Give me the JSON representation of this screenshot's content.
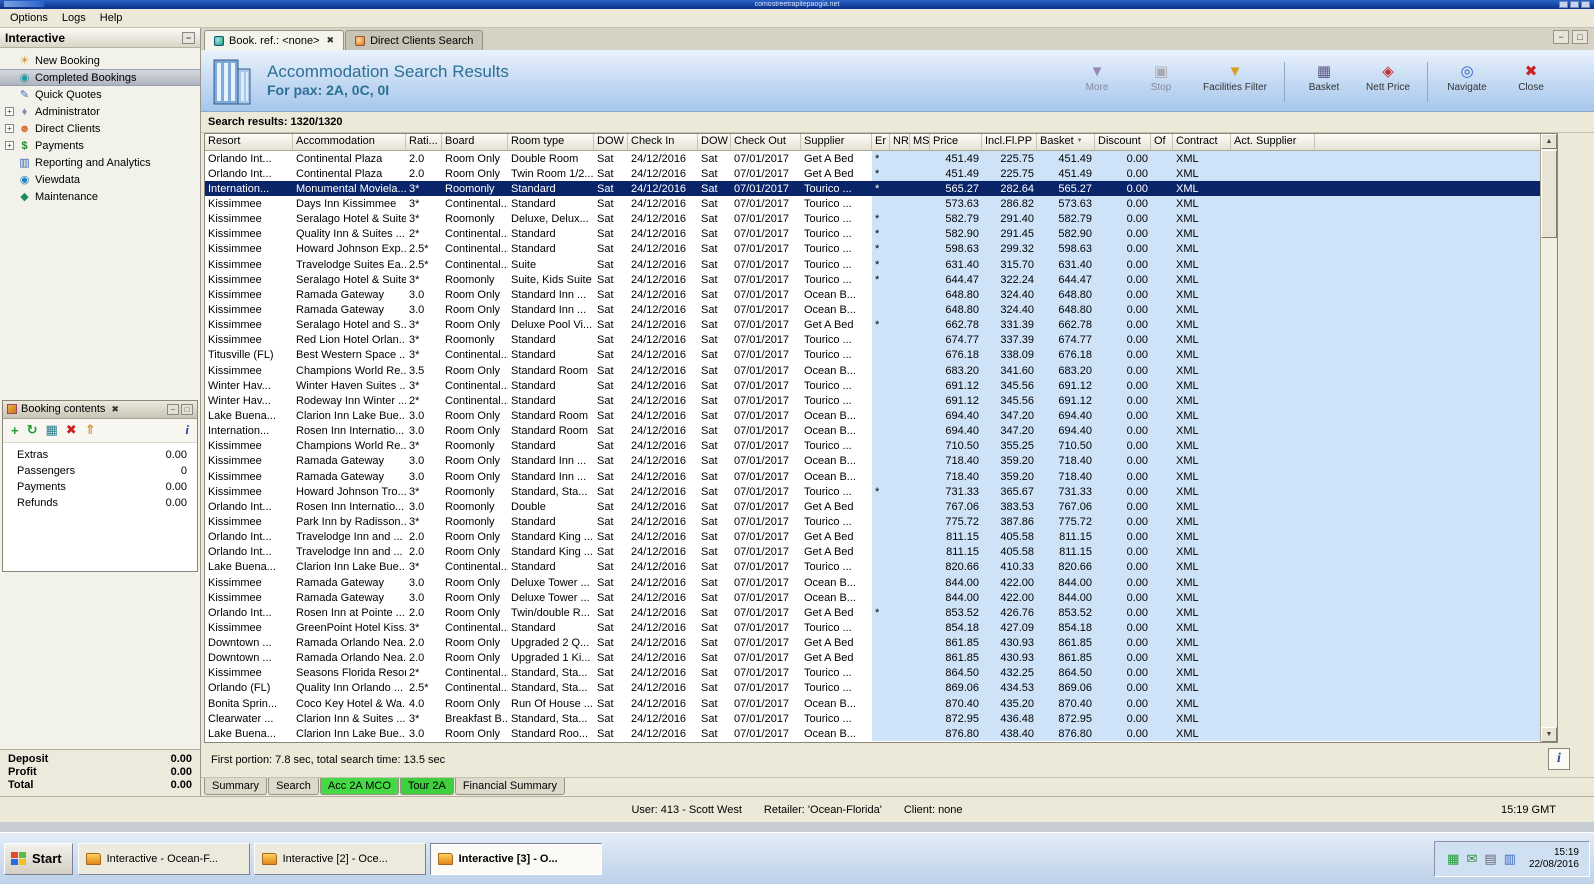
{
  "remote_bar": {
    "title": "comostreetrapitepaogia.net"
  },
  "menubar": {
    "items": [
      "Options",
      "Logs",
      "Help"
    ]
  },
  "sidebar": {
    "title": "Interactive",
    "items": [
      {
        "label": "New Booking",
        "icon": "palm-icon",
        "expandable": false,
        "selected": false
      },
      {
        "label": "Completed Bookings",
        "icon": "bookings-icon",
        "expandable": false,
        "selected": true
      },
      {
        "label": "Quick Quotes",
        "icon": "quotes-icon",
        "expandable": false,
        "selected": false
      },
      {
        "label": "Administrator",
        "icon": "admin-icon",
        "expandable": true,
        "selected": false
      },
      {
        "label": "Direct Clients",
        "icon": "clients-icon",
        "expandable": true,
        "selected": false
      },
      {
        "label": "Payments",
        "icon": "payments-icon",
        "expandable": true,
        "selected": false
      },
      {
        "label": "Reporting and Analytics",
        "icon": "reporting-icon",
        "expandable": false,
        "selected": false
      },
      {
        "label": "Viewdata",
        "icon": "viewdata-icon",
        "expandable": false,
        "selected": false
      },
      {
        "label": "Maintenance",
        "icon": "maintenance-icon",
        "expandable": false,
        "selected": false
      }
    ]
  },
  "booking_contents": {
    "title": "Booking contents",
    "rows": [
      {
        "label": "Extras",
        "value": "0.00"
      },
      {
        "label": "Passengers",
        "value": "0"
      },
      {
        "label": "Payments",
        "value": "0.00"
      },
      {
        "label": "Refunds",
        "value": "0.00"
      }
    ],
    "totals": [
      {
        "label": "Deposit",
        "value": "0.00"
      },
      {
        "label": "Profit",
        "value": "0.00"
      },
      {
        "label": "Total",
        "value": "0.00"
      }
    ]
  },
  "doc_tabs": [
    {
      "label": "Book. ref.: <none>",
      "active": true,
      "closable": true
    },
    {
      "label": "Direct Clients Search",
      "active": false,
      "closable": false
    }
  ],
  "results": {
    "title": "Accommodation Search Results",
    "subtitle": "For pax: 2A, 0C, 0I",
    "summary": "Search results: 1320/1320",
    "footer": "First portion: 7.8 sec, total search time: 13.5 sec",
    "toolbar": [
      {
        "label": "More",
        "icon": "more-icon",
        "enabled": false,
        "group_start": false
      },
      {
        "label": "Stop",
        "icon": "stop-icon",
        "enabled": false,
        "group_start": false
      },
      {
        "label": "Facilities Filter",
        "icon": "filter-icon",
        "enabled": true,
        "group_start": false,
        "wide": true
      },
      {
        "label": "Basket",
        "icon": "basket-btn-icon",
        "enabled": true,
        "group_start": true
      },
      {
        "label": "Nett Price",
        "icon": "nett-price-icon",
        "enabled": true,
        "group_start": false
      },
      {
        "label": "Navigate",
        "icon": "navigate-icon",
        "enabled": true,
        "group_start": true
      },
      {
        "label": "Close",
        "icon": "close-btn-icon",
        "enabled": true,
        "group_start": false
      }
    ]
  },
  "table": {
    "columns": [
      "Resort",
      "Accommodation",
      "Rati...",
      "Board",
      "Room type",
      "DOW",
      "Check In",
      "DOW",
      "Check Out",
      "Supplier",
      "Er",
      "NR",
      "MS",
      "Price",
      "Incl.Fl.PP",
      "Basket",
      "Discount",
      "Of",
      "Contract",
      "Act. Supplier"
    ],
    "defaults": {
      "dow": "Sat",
      "check_in": "24/12/2016",
      "check_out": "07/01/2017",
      "discount": "0.00",
      "contract": "XML"
    },
    "selected_index": 2,
    "rows": [
      [
        "Orlando Int...",
        "Continental Plaza",
        "2.0",
        "Room Only",
        "Double Room",
        "Get A Bed",
        "*",
        "451.49",
        "225.75",
        "451.49"
      ],
      [
        "Orlando Int...",
        "Continental Plaza",
        "2.0",
        "Room Only",
        "Twin Room 1/2...",
        "Get A Bed",
        "*",
        "451.49",
        "225.75",
        "451.49"
      ],
      [
        "Internation...",
        "Monumental Moviela...",
        "3*",
        "Roomonly",
        "Standard",
        "Tourico ...",
        "*",
        "565.27",
        "282.64",
        "565.27"
      ],
      [
        "Kissimmee",
        "Days Inn Kissimmee",
        "3*",
        "Continental...",
        "Standard",
        "Tourico ...",
        "",
        "573.63",
        "286.82",
        "573.63"
      ],
      [
        "Kissimmee",
        "Seralago Hotel & Suites",
        "3*",
        "Roomonly",
        "Deluxe, Delux...",
        "Tourico ...",
        "*",
        "582.79",
        "291.40",
        "582.79"
      ],
      [
        "Kissimmee",
        "Quality Inn & Suites ...",
        "2*",
        "Continental...",
        "Standard",
        "Tourico ...",
        "*",
        "582.90",
        "291.45",
        "582.90"
      ],
      [
        "Kissimmee",
        "Howard Johnson Exp...",
        "2.5*",
        "Continental...",
        "Standard",
        "Tourico ...",
        "*",
        "598.63",
        "299.32",
        "598.63"
      ],
      [
        "Kissimmee",
        "Travelodge Suites Ea...",
        "2.5*",
        "Continental...",
        "Suite",
        "Tourico ...",
        "*",
        "631.40",
        "315.70",
        "631.40"
      ],
      [
        "Kissimmee",
        "Seralago Hotel & Suites",
        "3*",
        "Roomonly",
        "Suite, Kids Suite",
        "Tourico ...",
        "*",
        "644.47",
        "322.24",
        "644.47"
      ],
      [
        "Kissimmee",
        "Ramada Gateway",
        "3.0",
        "Room Only",
        "Standard Inn ...",
        "Ocean B...",
        "",
        "648.80",
        "324.40",
        "648.80"
      ],
      [
        "Kissimmee",
        "Ramada Gateway",
        "3.0",
        "Room Only",
        "Standard Inn ...",
        "Ocean B...",
        "",
        "648.80",
        "324.40",
        "648.80"
      ],
      [
        "Kissimmee",
        "Seralago Hotel and S...",
        "3*",
        "Room Only",
        "Deluxe Pool Vi...",
        "Get A Bed",
        "*",
        "662.78",
        "331.39",
        "662.78"
      ],
      [
        "Kissimmee",
        "Red Lion Hotel Orlan...",
        "3*",
        "Roomonly",
        "Standard",
        "Tourico ...",
        "",
        "674.77",
        "337.39",
        "674.77"
      ],
      [
        "Titusville (FL)",
        "Best Western Space ...",
        "3*",
        "Continental...",
        "Standard",
        "Tourico ...",
        "",
        "676.18",
        "338.09",
        "676.18"
      ],
      [
        "Kissimmee",
        "Champions World Re...",
        "3.5",
        "Room Only",
        "Standard Room",
        "Ocean B...",
        "",
        "683.20",
        "341.60",
        "683.20"
      ],
      [
        "Winter Hav...",
        "Winter Haven Suites ...",
        "3*",
        "Continental...",
        "Standard",
        "Tourico ...",
        "",
        "691.12",
        "345.56",
        "691.12"
      ],
      [
        "Winter Hav...",
        "Rodeway Inn Winter ...",
        "2*",
        "Continental...",
        "Standard",
        "Tourico ...",
        "",
        "691.12",
        "345.56",
        "691.12"
      ],
      [
        "Lake Buena...",
        "Clarion Inn Lake Bue...",
        "3.0",
        "Room Only",
        "Standard Room",
        "Ocean B...",
        "",
        "694.40",
        "347.20",
        "694.40"
      ],
      [
        "Internation...",
        "Rosen Inn Internatio...",
        "3.0",
        "Room Only",
        "Standard Room",
        "Ocean B...",
        "",
        "694.40",
        "347.20",
        "694.40"
      ],
      [
        "Kissimmee",
        "Champions World Re...",
        "3*",
        "Roomonly",
        "Standard",
        "Tourico ...",
        "",
        "710.50",
        "355.25",
        "710.50"
      ],
      [
        "Kissimmee",
        "Ramada Gateway",
        "3.0",
        "Room Only",
        "Standard Inn ...",
        "Ocean B...",
        "",
        "718.40",
        "359.20",
        "718.40"
      ],
      [
        "Kissimmee",
        "Ramada Gateway",
        "3.0",
        "Room Only",
        "Standard Inn ...",
        "Ocean B...",
        "",
        "718.40",
        "359.20",
        "718.40"
      ],
      [
        "Kissimmee",
        "Howard Johnson Tro...",
        "3*",
        "Roomonly",
        "Standard, Sta...",
        "Tourico ...",
        "*",
        "731.33",
        "365.67",
        "731.33"
      ],
      [
        "Orlando Int...",
        "Rosen Inn Internatio...",
        "3.0",
        "Roomonly",
        "Double",
        "Get A Bed",
        "",
        "767.06",
        "383.53",
        "767.06"
      ],
      [
        "Kissimmee",
        "Park Inn by Radisson...",
        "3*",
        "Roomonly",
        "Standard",
        "Tourico ...",
        "",
        "775.72",
        "387.86",
        "775.72"
      ],
      [
        "Orlando Int...",
        "Travelodge Inn and ...",
        "2.0",
        "Room Only",
        "Standard King ...",
        "Get A Bed",
        "",
        "811.15",
        "405.58",
        "811.15"
      ],
      [
        "Orlando Int...",
        "Travelodge Inn and ...",
        "2.0",
        "Room Only",
        "Standard King ...",
        "Get A Bed",
        "",
        "811.15",
        "405.58",
        "811.15"
      ],
      [
        "Lake Buena...",
        "Clarion Inn Lake Bue...",
        "3*",
        "Continental...",
        "Standard",
        "Tourico ...",
        "",
        "820.66",
        "410.33",
        "820.66"
      ],
      [
        "Kissimmee",
        "Ramada Gateway",
        "3.0",
        "Room Only",
        "Deluxe Tower ...",
        "Ocean B...",
        "",
        "844.00",
        "422.00",
        "844.00"
      ],
      [
        "Kissimmee",
        "Ramada Gateway",
        "3.0",
        "Room Only",
        "Deluxe Tower ...",
        "Ocean B...",
        "",
        "844.00",
        "422.00",
        "844.00"
      ],
      [
        "Orlando Int...",
        "Rosen Inn at Pointe ...",
        "2.0",
        "Room Only",
        "Twin/double R...",
        "Get A Bed",
        "*",
        "853.52",
        "426.76",
        "853.52"
      ],
      [
        "Kissimmee",
        "GreenPoint Hotel Kiss...",
        "3*",
        "Continental...",
        "Standard",
        "Tourico ...",
        "",
        "854.18",
        "427.09",
        "854.18"
      ],
      [
        "Downtown ...",
        "Ramada Orlando Nea...",
        "2.0",
        "Room Only",
        "Upgraded 2 Q...",
        "Get A Bed",
        "",
        "861.85",
        "430.93",
        "861.85"
      ],
      [
        "Downtown ...",
        "Ramada Orlando Nea...",
        "2.0",
        "Room Only",
        "Upgraded 1 Ki...",
        "Get A Bed",
        "",
        "861.85",
        "430.93",
        "861.85"
      ],
      [
        "Kissimmee",
        "Seasons Florida Resort",
        "2*",
        "Continental...",
        "Standard, Sta...",
        "Tourico ...",
        "",
        "864.50",
        "432.25",
        "864.50"
      ],
      [
        "Orlando (FL)",
        "Quality Inn Orlando ...",
        "2.5*",
        "Continental...",
        "Standard, Sta...",
        "Tourico ...",
        "",
        "869.06",
        "434.53",
        "869.06"
      ],
      [
        "Bonita Sprin...",
        "Coco Key Hotel & Wa...",
        "4.0",
        "Room Only",
        "Run Of House ...",
        "Ocean B...",
        "",
        "870.40",
        "435.20",
        "870.40"
      ],
      [
        "Clearwater ...",
        "Clarion Inn & Suites ...",
        "3*",
        "Breakfast B...",
        "Standard, Sta...",
        "Tourico ...",
        "",
        "872.95",
        "436.48",
        "872.95"
      ],
      [
        "Lake Buena...",
        "Clarion Inn Lake Bue...",
        "3.0",
        "Room Only",
        "Standard Roo...",
        "Ocean B...",
        "",
        "876.80",
        "438.40",
        "876.80"
      ]
    ]
  },
  "bottom_tabs": [
    {
      "label": "Summary",
      "highlight": false,
      "active": false
    },
    {
      "label": "Search",
      "highlight": false,
      "active": false
    },
    {
      "label": "Acc 2A MCO",
      "highlight": true,
      "active": true
    },
    {
      "label": "Tour 2A",
      "highlight": true,
      "active": false
    },
    {
      "label": "Financial Summary",
      "highlight": false,
      "active": false
    }
  ],
  "statusbar": {
    "user": "User: 413 - Scott West",
    "retailer": "Retailer: 'Ocean-Florida'",
    "client": "Client: none",
    "time": "15:19 GMT"
  },
  "taskbar": {
    "start": "Start",
    "tasks": [
      {
        "label": "Interactive - Ocean-F...",
        "active": false
      },
      {
        "label": "Interactive [2] - Oce...",
        "active": false
      },
      {
        "label": "Interactive [3] - O...",
        "active": true
      }
    ],
    "clock": {
      "time": "15:19",
      "date": "22/08/2016"
    }
  },
  "colors": {
    "accent_blue": "#cfe3f8",
    "selection": "#0a246a",
    "header_teal": "#2d7095",
    "tab_green": "#3ecf3e"
  }
}
